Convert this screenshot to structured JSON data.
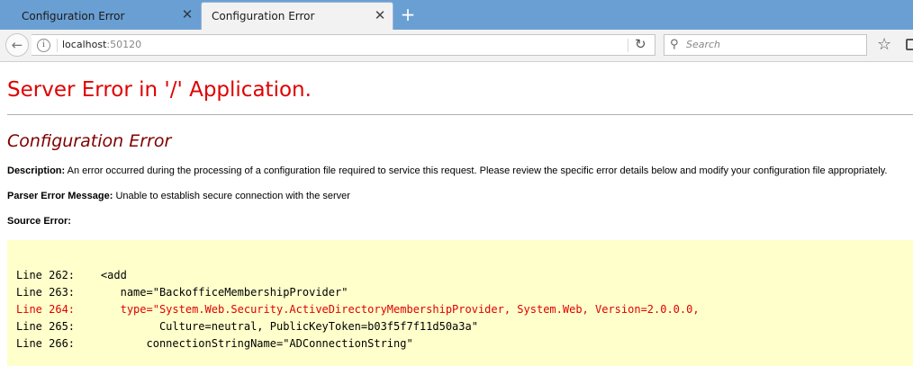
{
  "browser": {
    "tabs": [
      {
        "title": "Configuration Error",
        "active": false
      },
      {
        "title": "Configuration Error",
        "active": true
      }
    ],
    "url_host": "localhost",
    "url_port": ":50120",
    "search_placeholder": "Search",
    "accent_color": "#6a9fd3"
  },
  "page": {
    "title": "Server Error in '/' Application.",
    "subtitle": "Configuration Error",
    "description_label": "Description:",
    "description_text": "An error occurred during the processing of a configuration file required to service this request. Please review the specific error details below and modify your configuration file appropriately.",
    "parser_label": "Parser Error Message:",
    "parser_text": "Unable to establish secure connection with the server",
    "source_label": "Source Error:",
    "source_lines": [
      {
        "text": "Line 262:    <add",
        "error": false
      },
      {
        "text": "Line 263:       name=\"BackofficeMembershipProvider\"",
        "error": false
      },
      {
        "text": "Line 264:       type=\"System.Web.Security.ActiveDirectoryMembershipProvider, System.Web, Version=2.0.0.0,",
        "error": true
      },
      {
        "text": "Line 265:             Culture=neutral, PublicKeyToken=b03f5f7f11d50a3a\"",
        "error": false
      },
      {
        "text": "Line 266:           connectionStringName=\"ADConnectionString\"",
        "error": false
      }
    ],
    "title_color": "#e00000",
    "subtitle_color": "#800000",
    "code_background": "#ffffcc"
  }
}
